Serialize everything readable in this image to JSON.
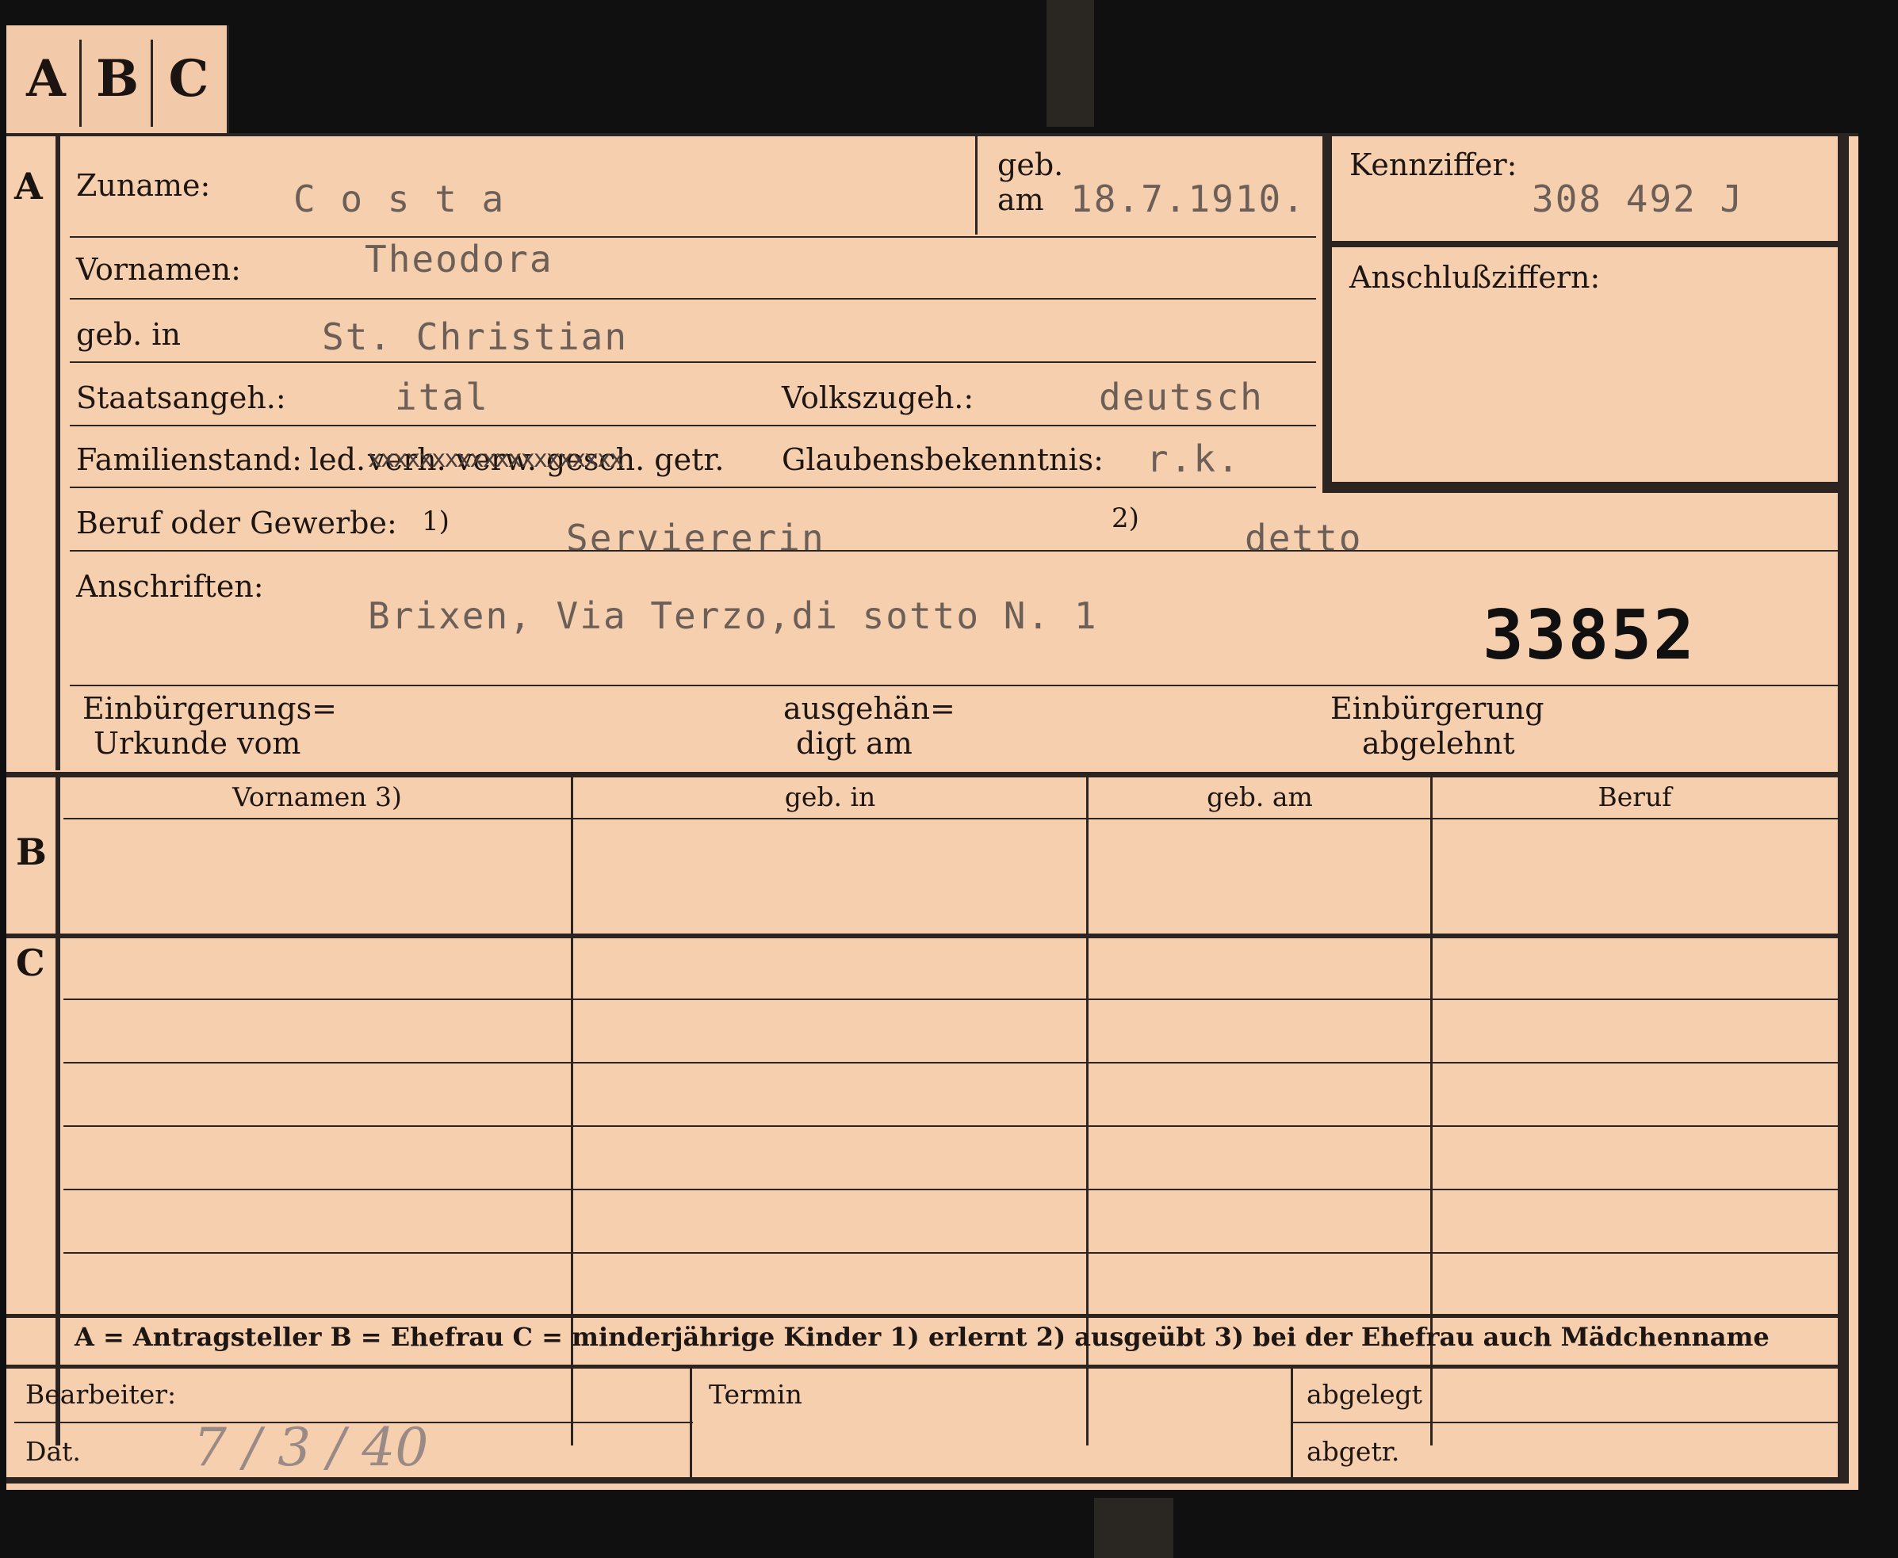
{
  "tab": {
    "a": "A",
    "b": "B",
    "c": "C"
  },
  "sections": {
    "a": "A",
    "b": "B",
    "c": "C"
  },
  "form": {
    "zuname_label": "Zuname:",
    "zuname_value": "C o s t a",
    "geb_label": "geb.",
    "am_label": "am",
    "birthdate_value": "18.7.1910.",
    "kennziffer_label": "Kennziffer:",
    "kennziffer_value": "308 492  J",
    "anschluss_label": "Anschlußziffern:",
    "vornamen_label": "Vornamen:",
    "vornamen_value": "Theodora",
    "gebin_label": "geb. in",
    "gebin_value": "St. Christian",
    "staats_label": "Staatsangeh.:",
    "staats_value": "ital",
    "volks_label": "Volkszugeh.:",
    "volks_value": "deutsch",
    "familien_label": "Familienstand:",
    "familien_led": "led.",
    "familien_struck": "verh. verw. gesch. getr.",
    "familien_xs": "xxxxxxxxxxxxxxxxxxxx",
    "glaubens_label": "Glaubensbekenntnis:",
    "glaubens_value": "r.k.",
    "beruf_label": "Beruf oder Gewerbe:",
    "beruf_note1": "1)",
    "beruf_value": "Serviererin",
    "beruf_note2": "2)",
    "beruf_value2": "detto",
    "anschriften_label": "Anschriften:",
    "anschriften_value": "Brixen, Via Terzo,di sotto  N. 1",
    "stamp_number": "33852",
    "einb_line1": "Einbürgerungs=",
    "einb_line2": "Urkunde vom",
    "ausg_line1": "ausgehän=",
    "ausg_line2": "digt am",
    "abgel_line1": "Einbürgerung",
    "abgel_line2": "abgelehnt"
  },
  "table_headers": {
    "vornamen": "Vornamen 3)",
    "gebin": "geb. in",
    "gebam": "geb. am",
    "beruf": "Beruf"
  },
  "legend": {
    "text": "A = Antragsteller   B = Ehefrau   C = minderjährige Kinder   1) erlernt   2) ausgeübt   3) bei der Ehefrau auch Mädchenname"
  },
  "footer": {
    "bearbeiter_label": "Bearbeiter:",
    "dat_label": "Dat.",
    "dat_value": "7  /  3  /  40",
    "termin_label": "Termin",
    "abgelegt_label": "abgelegt",
    "abgetr_label": "abgetr."
  }
}
